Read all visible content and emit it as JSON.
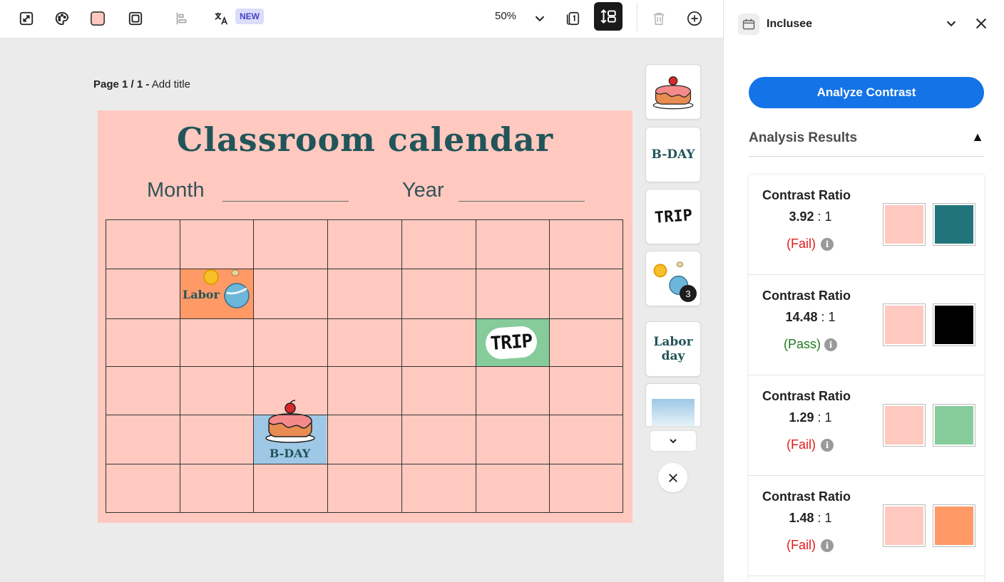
{
  "toolbar": {
    "new_badge": "NEW",
    "zoom": "50%",
    "icons": [
      "resize-icon",
      "palette-icon",
      "fill-color-icon",
      "border-icon",
      "align-icon",
      "translate-icon",
      "pages-icon",
      "layers-icon",
      "delete-icon",
      "add-icon"
    ]
  },
  "canvas": {
    "page_label_bold": "Page 1 / 1 -",
    "page_label_title": "Add title",
    "title": "Classroom calendar",
    "month_label": "Month",
    "year_label": "Year",
    "labor_day": "Labor day",
    "bday": "B-DAY",
    "trip": "TRIP",
    "background_color": "#ffc9bf"
  },
  "thumbnails": {
    "items": [
      "cake",
      "B-DAY",
      "TRIP",
      "sun-planet",
      "Labor day",
      "gradient"
    ],
    "bday_text": "B-DAY",
    "trip_text": "TRIP",
    "labor_text": "Labor day",
    "count_badge": "3"
  },
  "panel": {
    "plugin_name": "Inclusee",
    "analyze_button": "Analyze Contrast",
    "results_title": "Analysis Results",
    "results_toggle": "▲",
    "results": [
      {
        "title": "Contrast Ratio",
        "ratio": "3.92",
        "suffix": " : 1",
        "status": "(Fail)",
        "bg": "#ffc9bf",
        "fg": "#21757a"
      },
      {
        "title": "Contrast Ratio",
        "ratio": "14.48",
        "suffix": " : 1",
        "status": "(Pass)",
        "bg": "#ffc9bf",
        "fg": "#000000"
      },
      {
        "title": "Contrast Ratio",
        "ratio": "1.29",
        "suffix": " : 1",
        "status": "(Fail)",
        "bg": "#ffc9bf",
        "fg": "#85cc9a"
      },
      {
        "title": "Contrast Ratio",
        "ratio": "1.48",
        "suffix": " : 1",
        "status": "(Fail)",
        "bg": "#ffc9bf",
        "fg": "#ff9966"
      }
    ],
    "colors": {
      "fail": "#e21b1b",
      "pass": "#1e7d1e",
      "accent": "#1473e6"
    }
  }
}
